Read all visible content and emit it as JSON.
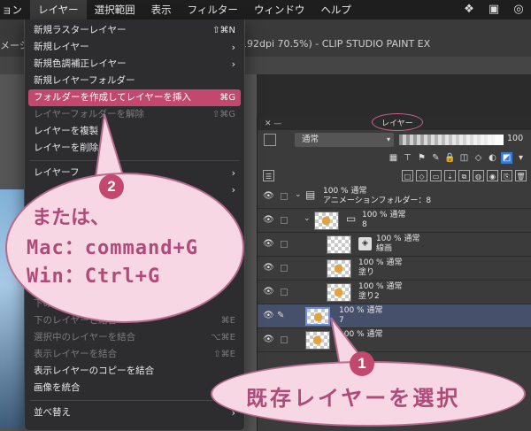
{
  "menubar": {
    "items": [
      "ョン",
      "レイヤー",
      "選択範囲",
      "表示",
      "フィルター",
      "ウィンドウ",
      "ヘルプ"
    ],
    "active_index": 1
  },
  "window": {
    "title_left": "メーショ",
    "title": "x 192dpi 70.5%) - CLIP STUDIO PAINT EX"
  },
  "menu": {
    "items": [
      {
        "label": "新規ラスターレイヤー",
        "shortcut": "⇧⌘N",
        "state": "normal"
      },
      {
        "label": "新規レイヤー",
        "arrow": "›",
        "state": "normal"
      },
      {
        "label": "新規色調補正レイヤー",
        "arrow": "›",
        "state": "normal"
      },
      {
        "label": "新規レイヤーフォルダー",
        "state": "normal"
      },
      {
        "label": "フォルダーを作成してレイヤーを挿入",
        "shortcut": "⌘G",
        "state": "highlighted"
      },
      {
        "label": "レイヤーフォルダーを解除",
        "shortcut": "⇧⌘G",
        "state": "disabled"
      },
      {
        "label": "レイヤーを複製",
        "state": "normal"
      },
      {
        "label": "レイヤーを削除",
        "state": "normal"
      },
      {
        "label": "レイヤーフ",
        "arrow": "›",
        "state": "normal"
      },
      {
        "label": "",
        "arrow": "›",
        "state": "normal"
      },
      {
        "label": "下のレイヤーに",
        "state": "disabled"
      },
      {
        "label": "下のレイヤーと結合",
        "shortcut": "⌘E",
        "state": "disabled"
      },
      {
        "label": "選択中のレイヤーを結合",
        "shortcut": "⌥⌘E",
        "state": "disabled"
      },
      {
        "label": "表示レイヤーを結合",
        "shortcut": "⇧⌘E",
        "state": "disabled"
      },
      {
        "label": "表示レイヤーのコピーを結合",
        "state": "normal"
      },
      {
        "label": "画像を統合",
        "state": "normal"
      },
      {
        "label": "並べ替え",
        "arrow": "›",
        "state": "normal"
      }
    ]
  },
  "palette": {
    "tab_label": "レイヤー",
    "blend_mode": "通常",
    "opacity": "100",
    "opacity_fraction": 1.0
  },
  "layers": [
    {
      "name": "アニメーションフォルダー：8",
      "opacity_mode": "100 % 通常",
      "kind": "anim-folder",
      "indent": 0
    },
    {
      "name": "8",
      "opacity_mode": "100 % 通常",
      "kind": "folder",
      "indent": 1
    },
    {
      "name": "線画",
      "opacity_mode": "100 % 通常",
      "kind": "vector",
      "indent": 2
    },
    {
      "name": "塗り",
      "opacity_mode": "100 % 通常",
      "kind": "raster",
      "indent": 2
    },
    {
      "name": "塗り2",
      "opacity_mode": "100 % 通常",
      "kind": "raster",
      "indent": 2
    },
    {
      "name": "7",
      "opacity_mode": "100 % 通常",
      "kind": "raster",
      "indent": 0,
      "selected": true
    },
    {
      "name": "6",
      "opacity_mode": "100 % 通常",
      "kind": "raster",
      "indent": 0
    }
  ],
  "annotations": {
    "step2_number": "2",
    "step2_line1": "または、",
    "step2_line2": "Mac：command+G",
    "step2_line3": "Win：Ctrl+G",
    "step1_number": "1",
    "step1_text": "既存レイヤーを選択",
    "accent_color": "#c2486f"
  }
}
